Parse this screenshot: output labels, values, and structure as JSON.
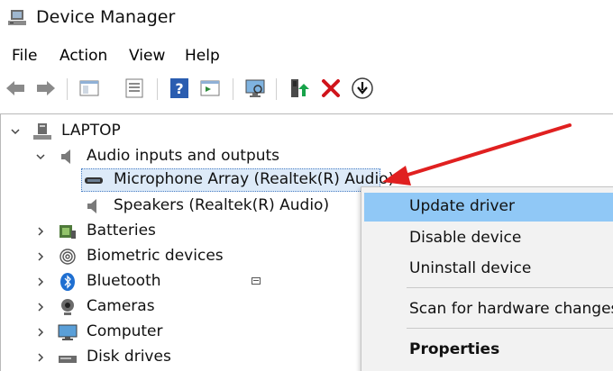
{
  "window": {
    "title": "Device Manager",
    "app_icon": "device-manager-icon"
  },
  "menu": {
    "file": "File",
    "action": "Action",
    "view": "View",
    "help": "Help"
  },
  "toolbar": {
    "icons": [
      "back-arrow-icon",
      "forward-arrow-icon",
      "show-hide-tree-icon",
      "properties-sheet-icon",
      "help-icon",
      "view-pane-icon",
      "scan-monitor-icon",
      "update-driver-icon",
      "uninstall-x-icon",
      "download-driver-icon"
    ]
  },
  "tree": {
    "root": "LAPTOP",
    "audio_category": "Audio inputs and outputs",
    "microphone": "Microphone Array (Realtek(R) Audio)",
    "speakers": "Speakers (Realtek(R) Audio)",
    "batteries": "Batteries",
    "biometric": "Biometric devices",
    "bluetooth": "Bluetooth",
    "cameras": "Cameras",
    "computer": "Computer",
    "disk_drives": "Disk drives"
  },
  "context_menu": {
    "update_driver": "Update driver",
    "disable_device": "Disable device",
    "uninstall_device": "Uninstall device",
    "scan": "Scan for hardware changes",
    "properties": "Properties"
  },
  "colors": {
    "highlight": "#90c8f6",
    "selection": "#ddeaf8",
    "annotation_arrow": "#e02020",
    "uninstall_red": "#d0141b",
    "update_green": "#18a34a"
  }
}
